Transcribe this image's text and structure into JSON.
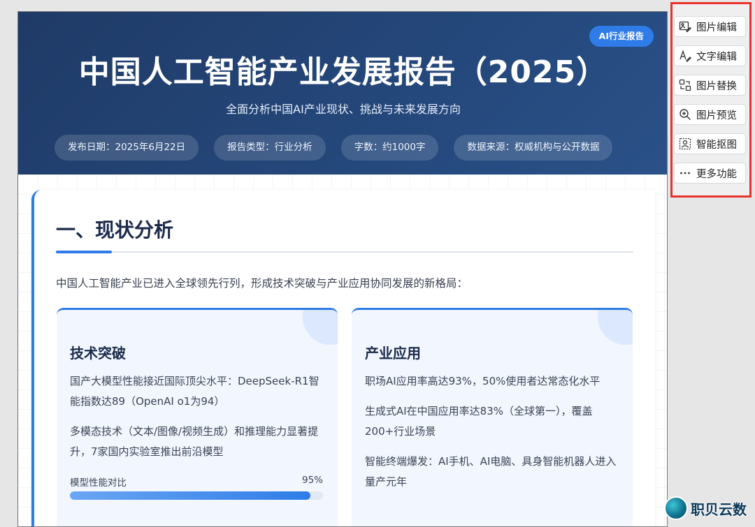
{
  "hero": {
    "badge": "AI行业报告",
    "title": "中国人工智能产业发展报告（2025）",
    "subtitle": "全面分析中国AI产业现状、挑战与未来发展方向",
    "meta": [
      "发布日期：2025年6月22日",
      "报告类型：行业分析",
      "字数：约1000字",
      "数据来源：权威机构与公开数据"
    ]
  },
  "section": {
    "heading": "一、现状分析",
    "intro": "中国人工智能产业已进入全球领先行列，形成技术突破与产业应用协同发展的新格局：",
    "cards": [
      {
        "title": "技术突破",
        "paragraphs": [
          "国产大模型性能接近国际顶尖水平：DeepSeek-R1智能指数达89（OpenAI o1为94）",
          "多模态技术（文本/图像/视频生成）和推理能力显著提升，7家国内实验室推出前沿模型"
        ],
        "progress_label": "模型性能对比",
        "progress_value_text": "95%",
        "progress_value": 0.95
      },
      {
        "title": "产业应用",
        "paragraphs": [
          "职场AI应用率高达93%，50%使用者达常态化水平",
          "生成式AI在中国应用率达83%（全球第一），覆盖200+行业场景",
          "智能终端爆发：AI手机、AI电脑、具身智能机器人进入量产元年"
        ]
      }
    ]
  },
  "side_panel": {
    "tools": [
      {
        "label": "图片编辑",
        "icon": "image-edit-icon"
      },
      {
        "label": "文字编辑",
        "icon": "text-edit-icon"
      },
      {
        "label": "图片替换",
        "icon": "image-replace-icon"
      },
      {
        "label": "图片预览",
        "icon": "zoom-in-icon"
      },
      {
        "label": "智能抠图",
        "icon": "smart-cutout-icon"
      },
      {
        "label": "更多功能",
        "icon": "more-icon"
      }
    ]
  },
  "watermark": {
    "text": "职贝云数"
  },
  "colors": {
    "hero_bg": "#24477a",
    "accent": "#2f7ce8",
    "highlight_border": "#e8322b"
  }
}
